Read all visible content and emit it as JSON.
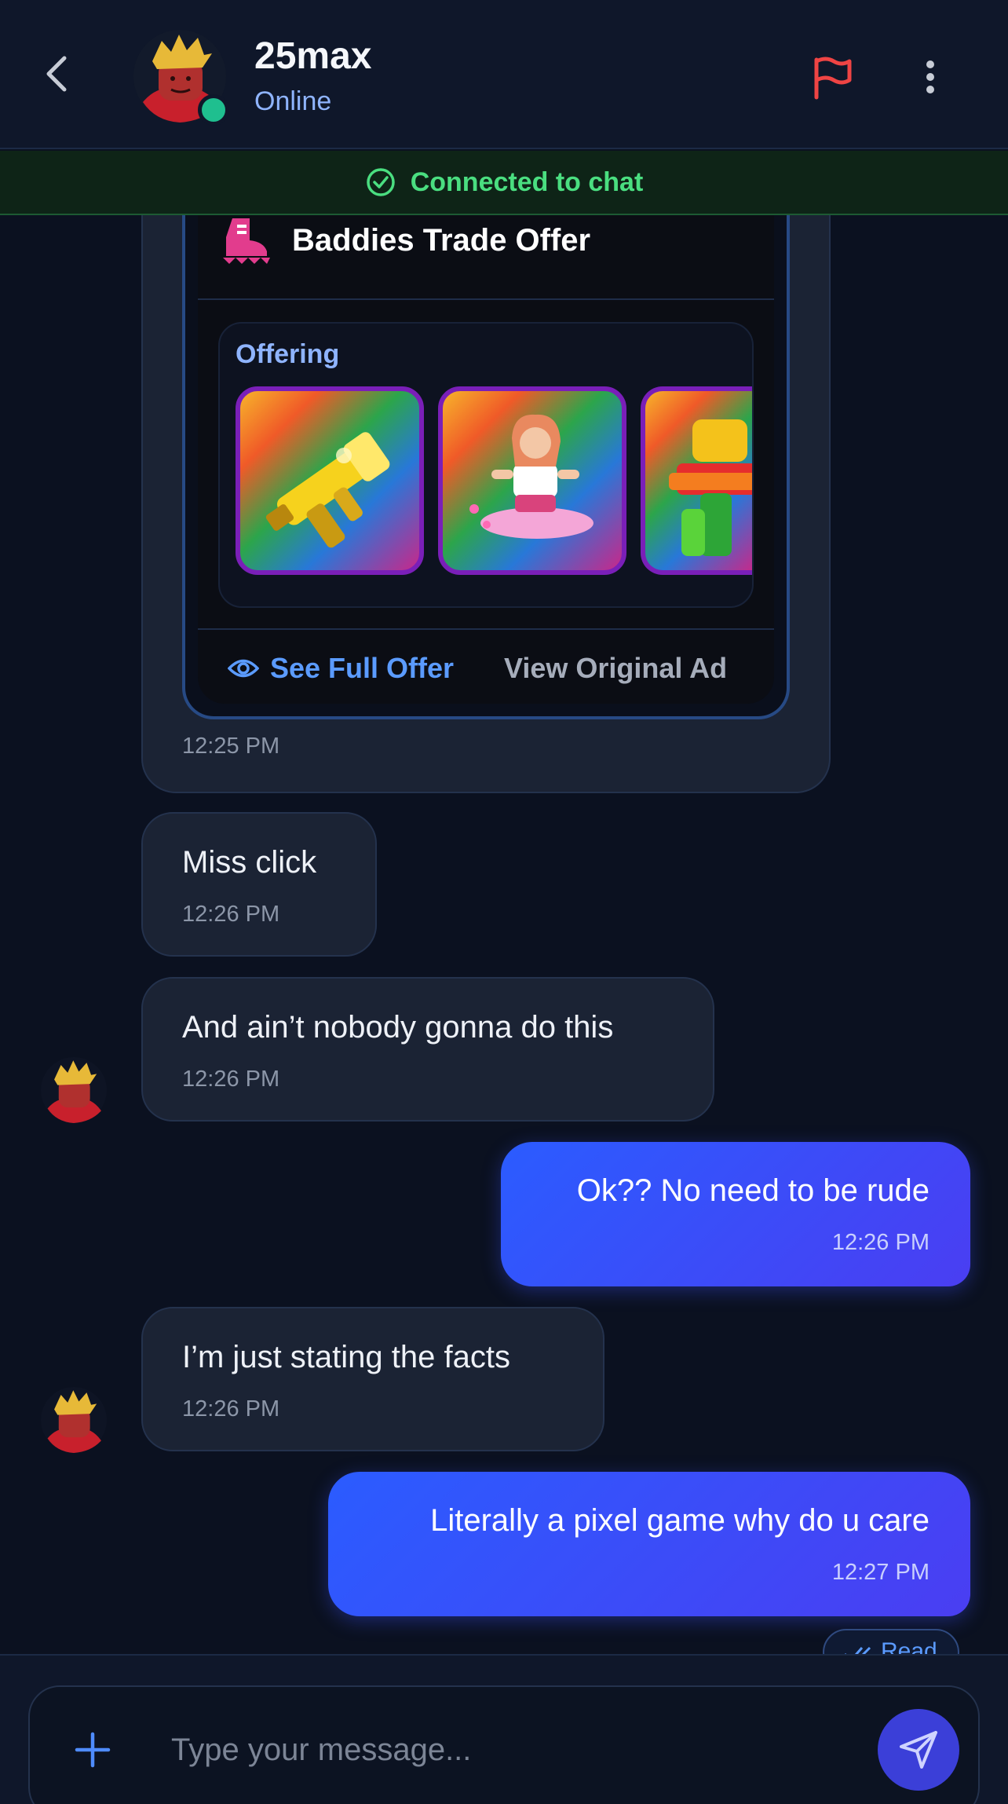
{
  "header": {
    "username": "25max",
    "status": "Online",
    "icons": [
      "back-chevron-icon",
      "avatar",
      "flag-icon",
      "more-vertical-icon"
    ],
    "colors": {
      "flag": "#ef4444",
      "online": "#1fbf8f",
      "status_text": "#8fb4ff"
    }
  },
  "banner": {
    "text": "Connected to chat",
    "color": "#4ade80"
  },
  "offer": {
    "title": "Baddies Trade Offer",
    "section_label": "Offering",
    "items": [
      "golden-gun-item",
      "skater-girl-item",
      "rainbow-character-item"
    ],
    "see_full": "See Full Offer",
    "view_original": "View Original Ad",
    "time": "12:25 PM"
  },
  "messages": [
    {
      "sender": "them",
      "text": "Miss click",
      "time": "12:26 PM"
    },
    {
      "sender": "them",
      "text": "And ain’t nobody gonna do this",
      "time": "12:26 PM"
    },
    {
      "sender": "me",
      "text": "Ok?? No need to be rude",
      "time": "12:26 PM"
    },
    {
      "sender": "them",
      "text": "I’m just stating the facts",
      "time": "12:26 PM"
    },
    {
      "sender": "me",
      "text": "Literally a pixel game why do u care",
      "time": "12:27 PM"
    }
  ],
  "read_receipt": "Read",
  "composer": {
    "placeholder": "Type your message...",
    "accent": "#3b3fd8"
  }
}
